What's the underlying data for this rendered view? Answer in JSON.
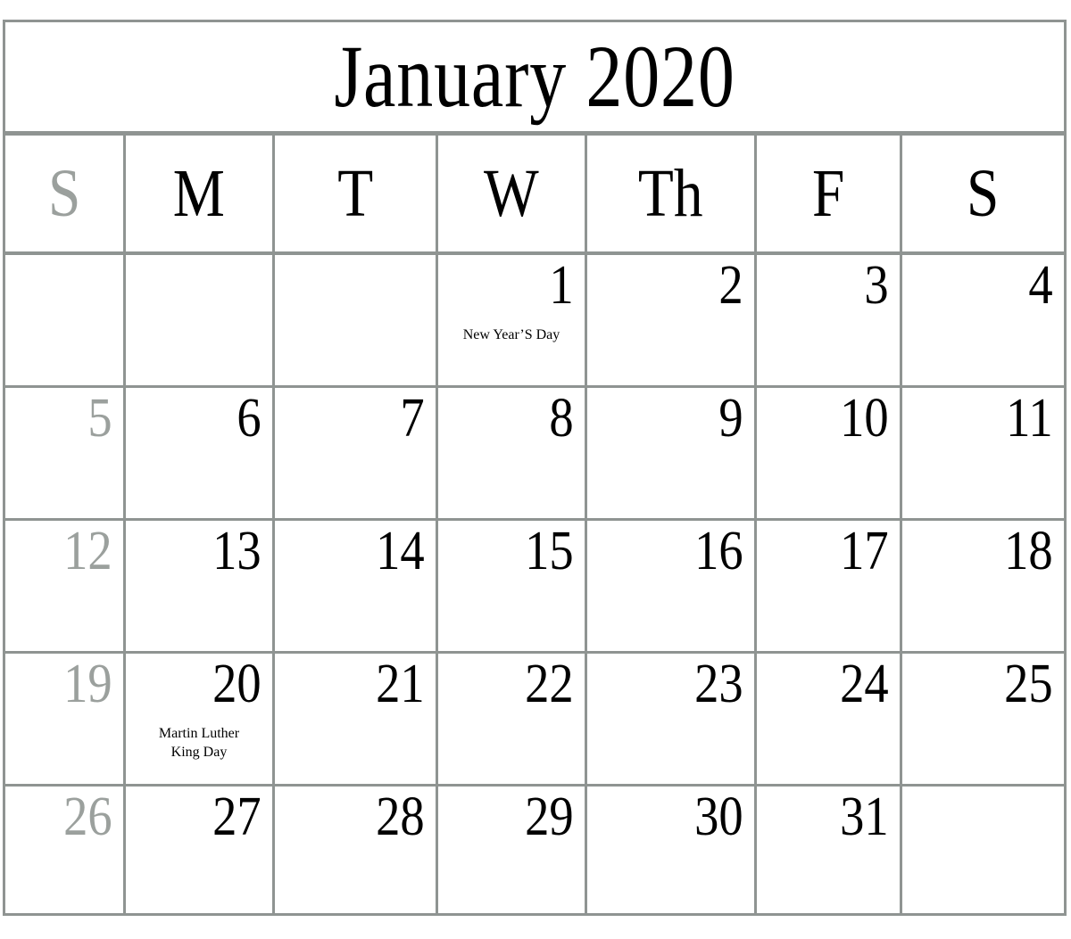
{
  "calendar": {
    "title": "January 2020",
    "month": "January",
    "year": "2020",
    "colors": {
      "grid_border": "#8f9492",
      "text": "#000000",
      "muted_text": "#9ba09d",
      "background": "#ffffff"
    },
    "weekday_headers": [
      {
        "label": "S",
        "name": "sunday",
        "muted": true
      },
      {
        "label": "M",
        "name": "monday",
        "muted": false
      },
      {
        "label": "T",
        "name": "tuesday",
        "muted": false
      },
      {
        "label": "W",
        "name": "wednesday",
        "muted": false
      },
      {
        "label": "Th",
        "name": "thursday",
        "muted": false
      },
      {
        "label": "F",
        "name": "friday",
        "muted": false
      },
      {
        "label": "S",
        "name": "saturday",
        "muted": false
      }
    ],
    "weeks": [
      {
        "days": [
          {
            "num": "",
            "holiday": ""
          },
          {
            "num": "",
            "holiday": ""
          },
          {
            "num": "",
            "holiday": ""
          },
          {
            "num": "1",
            "holiday": "New Year’S Day"
          },
          {
            "num": "2",
            "holiday": ""
          },
          {
            "num": "3",
            "holiday": ""
          },
          {
            "num": "4",
            "holiday": ""
          }
        ]
      },
      {
        "days": [
          {
            "num": "5",
            "holiday": ""
          },
          {
            "num": "6",
            "holiday": ""
          },
          {
            "num": "7",
            "holiday": ""
          },
          {
            "num": "8",
            "holiday": ""
          },
          {
            "num": "9",
            "holiday": ""
          },
          {
            "num": "10",
            "holiday": ""
          },
          {
            "num": "11",
            "holiday": ""
          }
        ]
      },
      {
        "days": [
          {
            "num": "12",
            "holiday": ""
          },
          {
            "num": "13",
            "holiday": ""
          },
          {
            "num": "14",
            "holiday": ""
          },
          {
            "num": "15",
            "holiday": ""
          },
          {
            "num": "16",
            "holiday": ""
          },
          {
            "num": "17",
            "holiday": ""
          },
          {
            "num": "18",
            "holiday": ""
          }
        ]
      },
      {
        "days": [
          {
            "num": "19",
            "holiday": ""
          },
          {
            "num": "20",
            "holiday": "Martin Luther\nKing Day"
          },
          {
            "num": "21",
            "holiday": ""
          },
          {
            "num": "22",
            "holiday": ""
          },
          {
            "num": "23",
            "holiday": ""
          },
          {
            "num": "24",
            "holiday": ""
          },
          {
            "num": "25",
            "holiday": ""
          }
        ]
      },
      {
        "days": [
          {
            "num": "26",
            "holiday": ""
          },
          {
            "num": "27",
            "holiday": ""
          },
          {
            "num": "28",
            "holiday": ""
          },
          {
            "num": "29",
            "holiday": ""
          },
          {
            "num": "30",
            "holiday": ""
          },
          {
            "num": "31",
            "holiday": ""
          },
          {
            "num": "",
            "holiday": ""
          }
        ]
      }
    ]
  }
}
